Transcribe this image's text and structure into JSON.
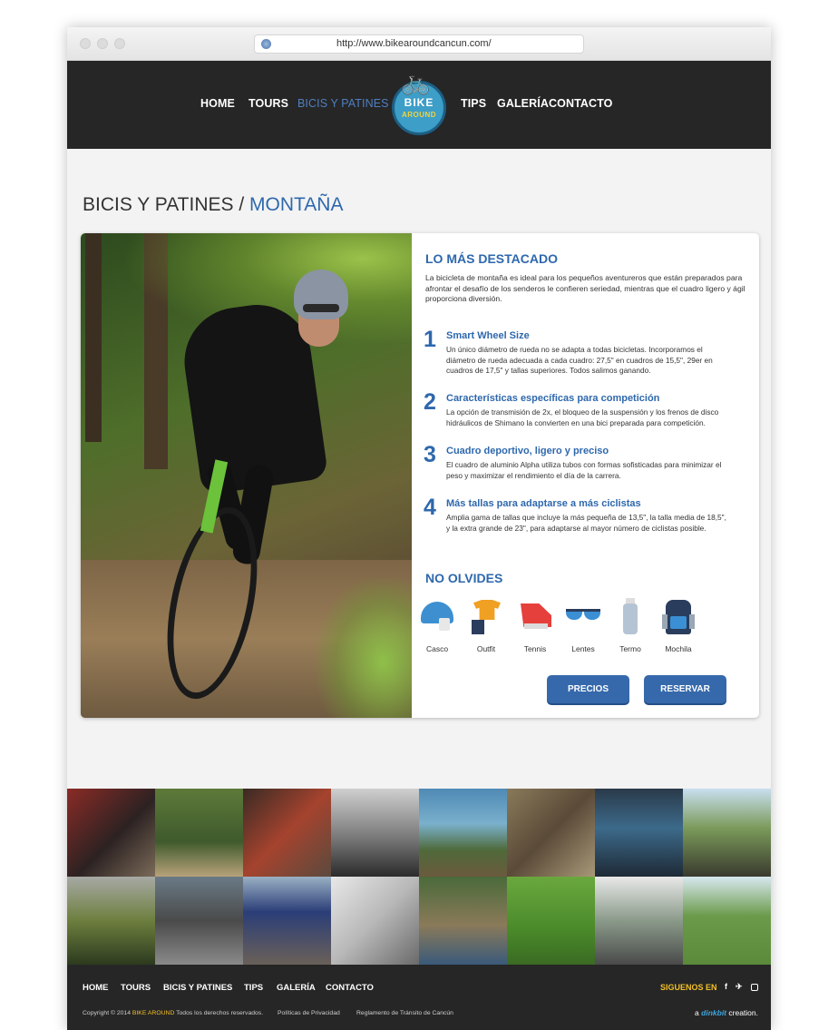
{
  "browser": {
    "url": "http://www.bikearoundcancun.com/"
  },
  "header": {
    "nav_left": [
      "HOME",
      "TOURS",
      "BICIS Y PATINES"
    ],
    "nav_right": [
      "TIPS",
      "GALERÍA",
      "CONTACTO"
    ],
    "active": "BICIS Y PATINES",
    "logo_line1": "BIKE",
    "logo_line2": "AROUND"
  },
  "page": {
    "title_main": "BICIS Y PATINES / ",
    "title_sub": "MONTAÑA"
  },
  "highlights": {
    "heading": "LO MÁS DESTACADO",
    "intro": "La bicicleta de montaña  es ideal para los pequeños aventureros que están preparados para afrontar el desafío de los senderos le confieren seriedad, mientras que el cuadro ligero y ágil proporciona diversión.",
    "features": [
      {
        "num": "1",
        "title": "Smart Wheel Size",
        "text": "Un único diámetro de rueda no se adapta a todas bicicletas. Incorporamos el diámetro de rueda adecuada a cada cuadro: 27,5\" en cuadros de 15,5\", 29er en cuadros de 17,5\" y tallas superiores. Todos salimos ganando."
      },
      {
        "num": "2",
        "title": "Características específicas para competición",
        "text": "La opción de transmisión de 2x, el bloqueo de la suspensión y los frenos de disco hidráulicos de Shimano la convierten en una bici preparada para competición."
      },
      {
        "num": "3",
        "title": "Cuadro deportivo, ligero y preciso",
        "text": "El cuadro de aluminio Alpha utiliza tubos con formas sofisticadas para minimizar el peso y maximizar el rendimiento el día de la carrera."
      },
      {
        "num": "4",
        "title": "Más tallas para adaptarse a más ciclistas",
        "text": "Amplia gama de tallas que incluye la más pequeña de 13,5\", la talla media de 18,5\", y la extra grande de 23\", para adaptarse al mayor número de ciclistas posible."
      }
    ]
  },
  "remember": {
    "heading": "NO OLVIDES",
    "items": [
      {
        "label": "Casco",
        "icon": "helmet-icon"
      },
      {
        "label": "Outfit",
        "icon": "outfit-icon"
      },
      {
        "label": "Tennis",
        "icon": "sneaker-icon"
      },
      {
        "label": "Lentes",
        "icon": "glasses-icon"
      },
      {
        "label": "Termo",
        "icon": "bottle-icon"
      },
      {
        "label": "Mochila",
        "icon": "backpack-icon"
      }
    ]
  },
  "actions": {
    "prices": "PRECIOS",
    "book": "RESERVAR"
  },
  "footer": {
    "links": [
      "HOME",
      "TOURS",
      "BICIS Y PATINES",
      "TIPS",
      "GALERÍA",
      "CONTACTO"
    ],
    "follow_label": "SIGUENOS EN",
    "social": [
      "facebook-icon",
      "twitter-icon",
      "instagram-icon"
    ],
    "copyright_prefix": "Copyright © 2014",
    "copyright_brand": "BIKE AROUND",
    "copyright_suffix": "Todos los derechos reservados.",
    "privacy": "Políticas de Privacidad",
    "rules": "Reglamento de Tránsito de Cancún",
    "credit_prefix": "a",
    "credit_brand": "dinkbit",
    "credit_suffix": "creation."
  },
  "colors": {
    "accent": "#2e68ad",
    "header_bg": "#262626",
    "button": "#3669ab",
    "highlight_yellow": "#f2c026"
  }
}
